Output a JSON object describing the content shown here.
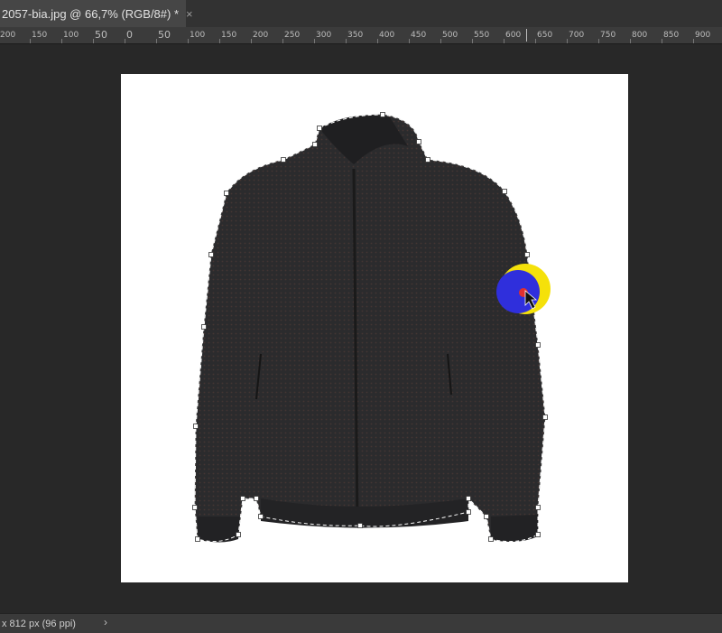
{
  "document_tab": {
    "title": "2057-bia.jpg @ 66,7% (RGB/8#) *",
    "close_glyph": "×"
  },
  "ruler": {
    "labels": [
      "200",
      "150",
      "100",
      "50",
      "0",
      "50",
      "100",
      "150",
      "200",
      "250",
      "300",
      "350",
      "400",
      "450",
      "500",
      "550",
      "600",
      "650",
      "700",
      "750",
      "800",
      "850",
      "900"
    ]
  },
  "status_bar": {
    "doc_info": "x 812 px (96 ppi)",
    "menu_arrow": "›"
  },
  "canvas": {
    "background": "#ffffff",
    "subject": "black bomber jacket",
    "jacket_color": "#2a2a2c",
    "selection_path": "marching-ants"
  },
  "cursor": {
    "icon": "pen-tool-cursor-icon",
    "highlight_outer": "#f5e10a",
    "highlight_inner": "#2f2fdc"
  },
  "colors": {
    "app_background": "#282828",
    "tab_active": "#464646",
    "ruler_bg": "#3b3b3b"
  }
}
